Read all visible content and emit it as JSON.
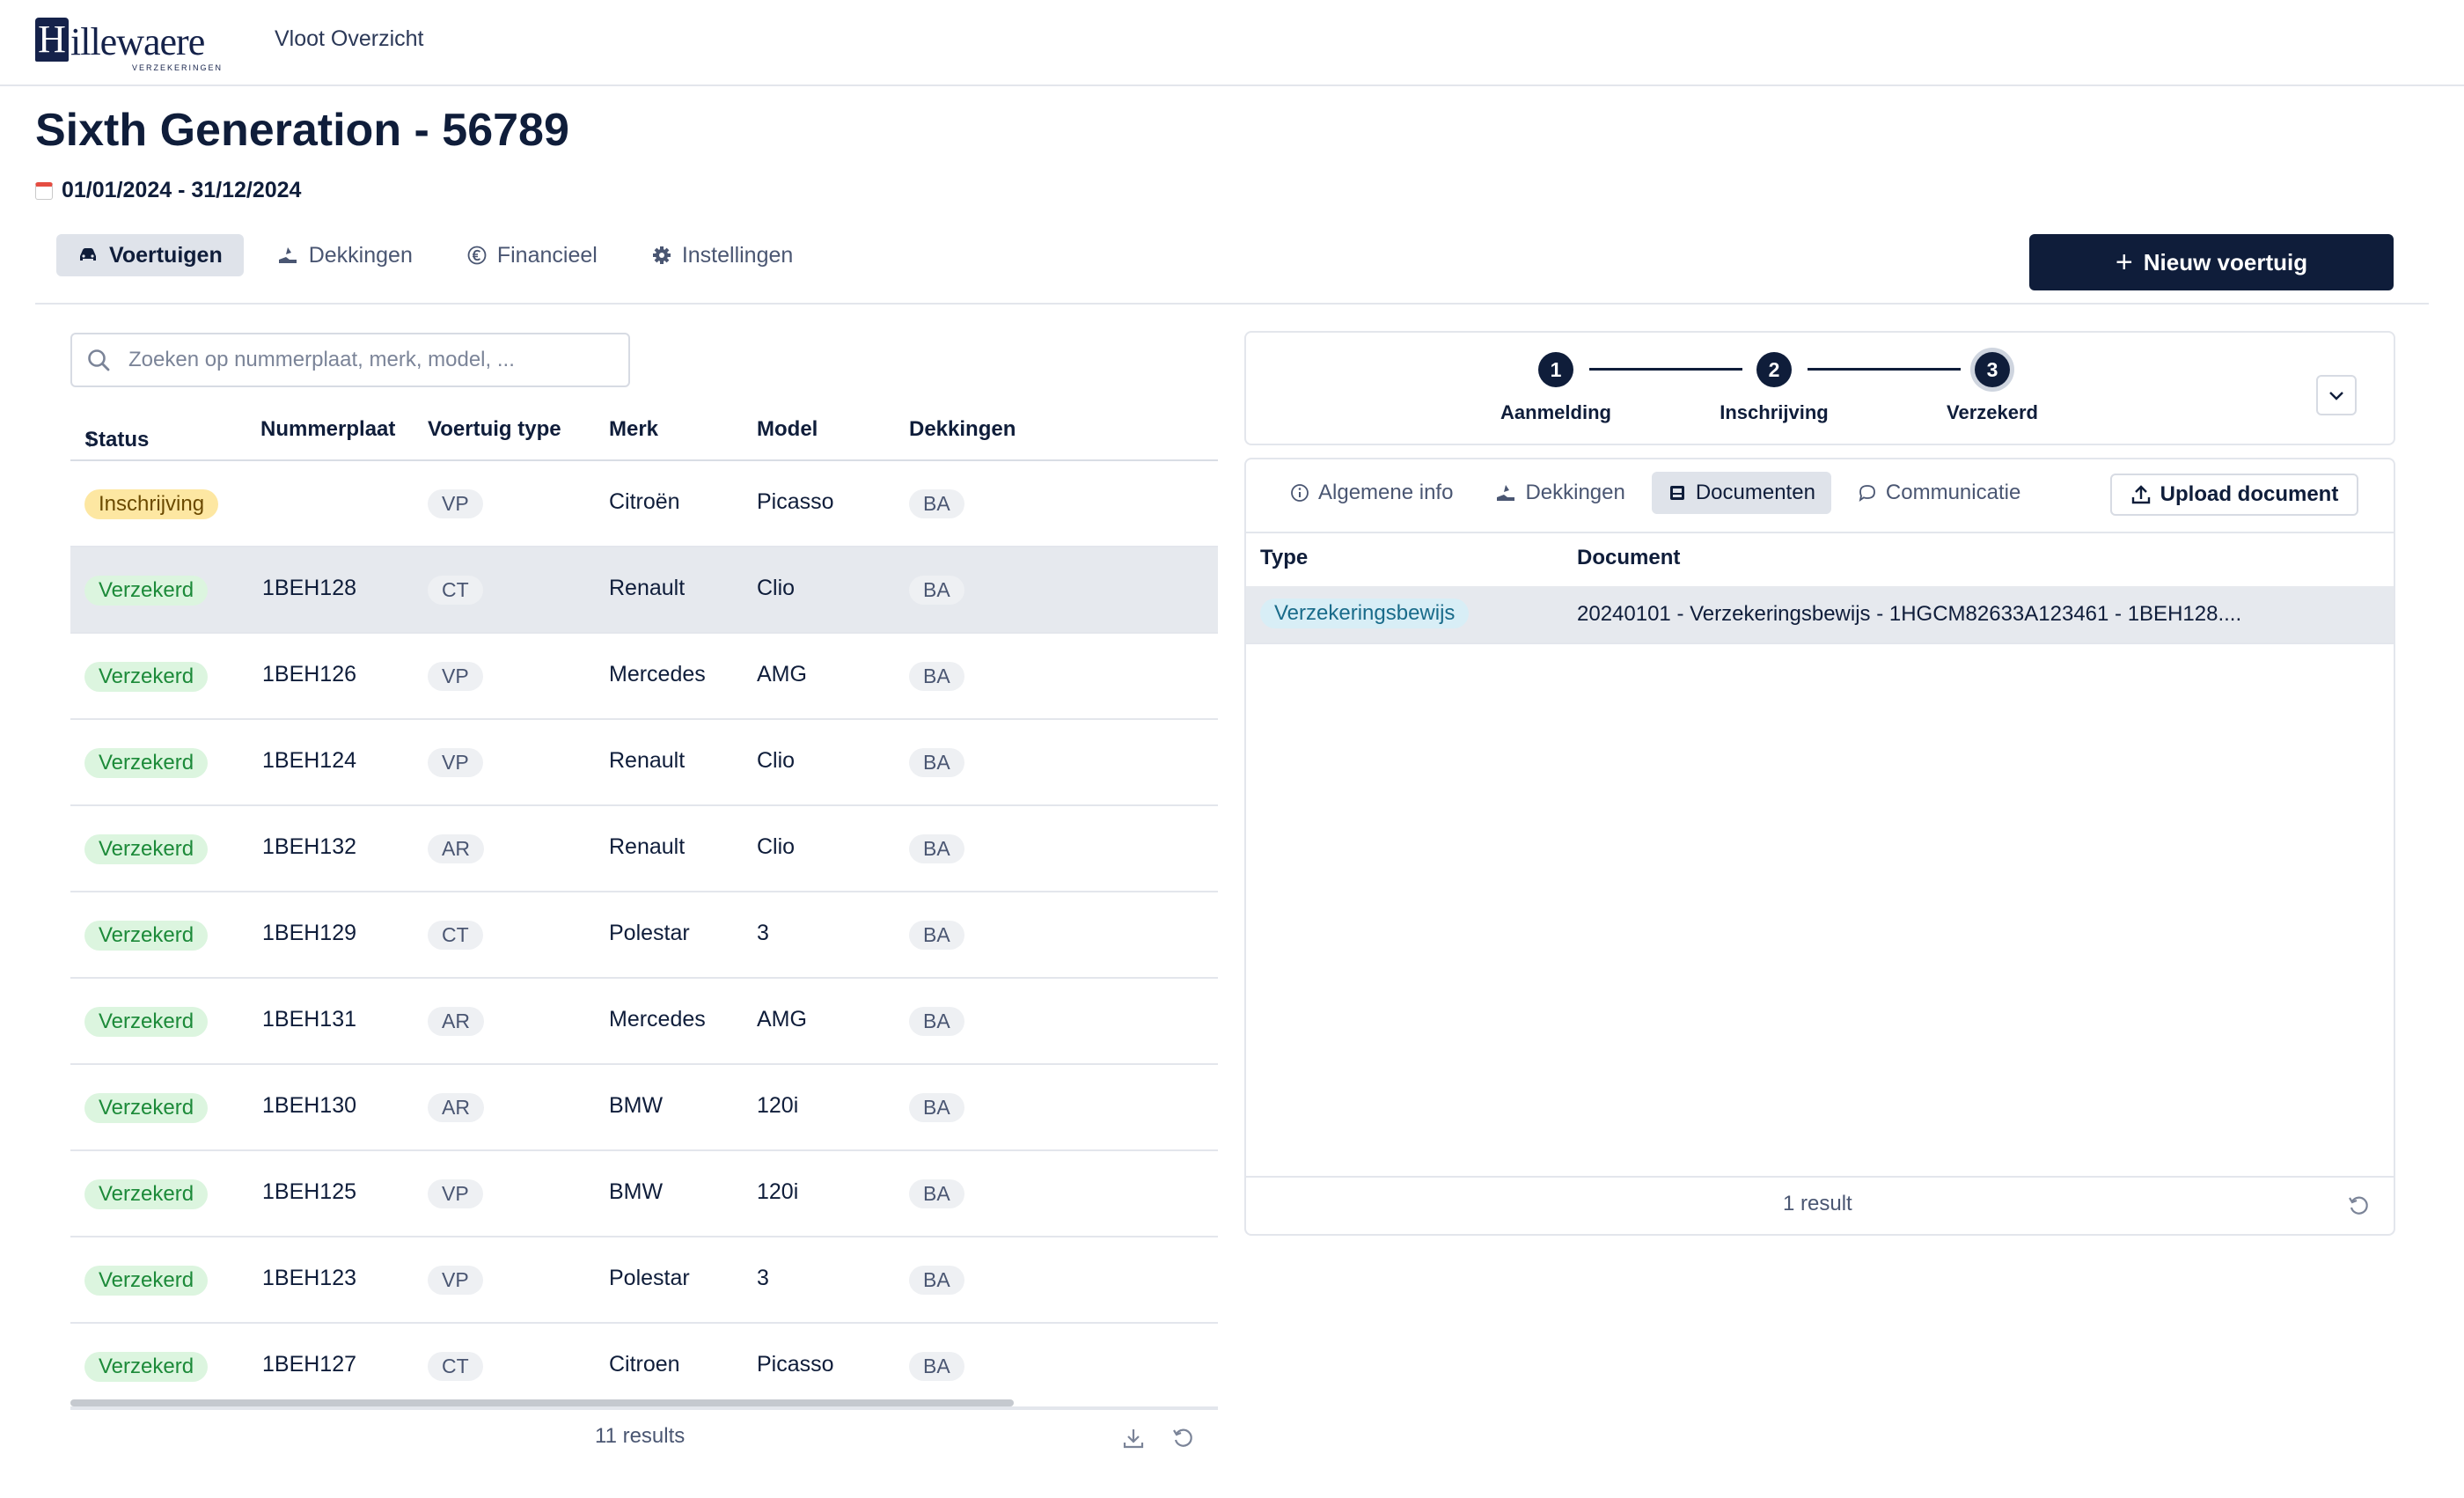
{
  "topbar": {
    "logo_text": "illewaere",
    "logo_letter": "H",
    "logo_sub": "VERZEKERINGEN",
    "nav_link": "Vloot Overzicht"
  },
  "header": {
    "title": "Sixth Generation - 56789",
    "date_range": "01/01/2024 - 31/12/2024"
  },
  "tabs": [
    {
      "label": "Voertuigen",
      "icon": "car-icon",
      "active": true
    },
    {
      "label": "Dekkingen",
      "icon": "coverage-icon",
      "active": false
    },
    {
      "label": "Financieel",
      "icon": "euro-icon",
      "active": false
    },
    {
      "label": "Instellingen",
      "icon": "gear-icon",
      "active": false
    }
  ],
  "new_vehicle_button": "Nieuw voertuig",
  "search": {
    "placeholder": "Zoeken op nummerplaat, merk, model, ..."
  },
  "vehicles_table": {
    "columns": [
      "Status",
      "Nummerplaat",
      "Voertuig type",
      "Merk",
      "Model",
      "Dekkingen"
    ],
    "sort_indicator": "↑",
    "rows": [
      {
        "status": "Inschrijving",
        "plate": "",
        "type": "VP",
        "merk": "Citroën",
        "model": "Picasso",
        "dekkingen": "BA"
      },
      {
        "status": "Verzekerd",
        "plate": "1BEH128",
        "type": "CT",
        "merk": "Renault",
        "model": "Clio",
        "dekkingen": "BA"
      },
      {
        "status": "Verzekerd",
        "plate": "1BEH126",
        "type": "VP",
        "merk": "Mercedes",
        "model": "AMG",
        "dekkingen": "BA"
      },
      {
        "status": "Verzekerd",
        "plate": "1BEH124",
        "type": "VP",
        "merk": "Renault",
        "model": "Clio",
        "dekkingen": "BA"
      },
      {
        "status": "Verzekerd",
        "plate": "1BEH132",
        "type": "AR",
        "merk": "Renault",
        "model": "Clio",
        "dekkingen": "BA"
      },
      {
        "status": "Verzekerd",
        "plate": "1BEH129",
        "type": "CT",
        "merk": "Polestar",
        "model": "3",
        "dekkingen": "BA"
      },
      {
        "status": "Verzekerd",
        "plate": "1BEH131",
        "type": "AR",
        "merk": "Mercedes",
        "model": "AMG",
        "dekkingen": "BA"
      },
      {
        "status": "Verzekerd",
        "plate": "1BEH130",
        "type": "AR",
        "merk": "BMW",
        "model": "120i",
        "dekkingen": "BA"
      },
      {
        "status": "Verzekerd",
        "plate": "1BEH125",
        "type": "VP",
        "merk": "BMW",
        "model": "120i",
        "dekkingen": "BA"
      },
      {
        "status": "Verzekerd",
        "plate": "1BEH123",
        "type": "VP",
        "merk": "Polestar",
        "model": "3",
        "dekkingen": "BA"
      },
      {
        "status": "Verzekerd",
        "plate": "1BEH127",
        "type": "CT",
        "merk": "Citroen",
        "model": "Picasso",
        "dekkingen": "BA"
      }
    ],
    "selected_row": 1,
    "results": "11 results"
  },
  "progress": {
    "steps": [
      {
        "number": "1",
        "label": "Aanmelding"
      },
      {
        "number": "2",
        "label": "Inschrijving"
      },
      {
        "number": "3",
        "label": "Verzekerd"
      }
    ],
    "current_step": 3
  },
  "detail_tabs": [
    {
      "label": "Algemene info",
      "icon": "info-icon",
      "active": false
    },
    {
      "label": "Dekkingen",
      "icon": "coverage-icon",
      "active": false
    },
    {
      "label": "Documenten",
      "icon": "document-icon",
      "active": true
    },
    {
      "label": "Communicatie",
      "icon": "chat-icon",
      "active": false
    }
  ],
  "upload_button": "Upload document",
  "documents_table": {
    "columns": [
      "Type",
      "Document"
    ],
    "rows": [
      {
        "type": "Verzekeringsbewijs",
        "document": "20240101 - Verzekeringsbewijs - 1HGCM82633A123461 - 1BEH128...."
      }
    ],
    "results": "1 result"
  },
  "colors": {
    "primary": "#0f1d3a",
    "status_verzekerd_bg": "#dcf5df",
    "status_verzekerd_fg": "#1c8a39",
    "status_inschrijving_bg": "#fde7a2",
    "doc_type_bg": "#d8eef6"
  }
}
